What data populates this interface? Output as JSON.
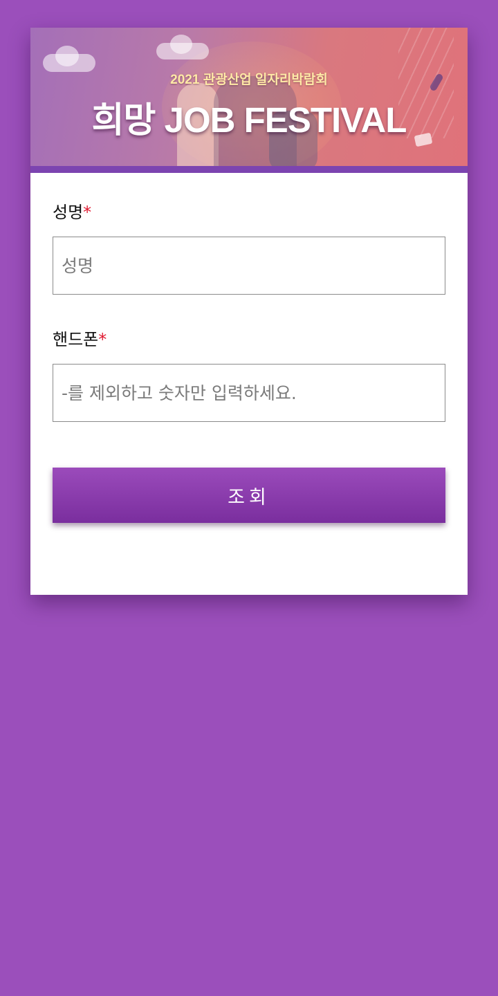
{
  "banner": {
    "subtitle": "2021 관광산업 일자리박람회",
    "title": "희망 JOB FESTIVAL"
  },
  "form": {
    "name_label": "성명",
    "name_placeholder": "성명",
    "phone_label": "핸드폰",
    "phone_placeholder": "-를 제외하고 숫자만 입력하세요.",
    "required_mark": "*",
    "submit_label": "조회"
  },
  "colors": {
    "background": "#9b4fbb",
    "button": "#8a3cad",
    "required": "#e0182f"
  }
}
